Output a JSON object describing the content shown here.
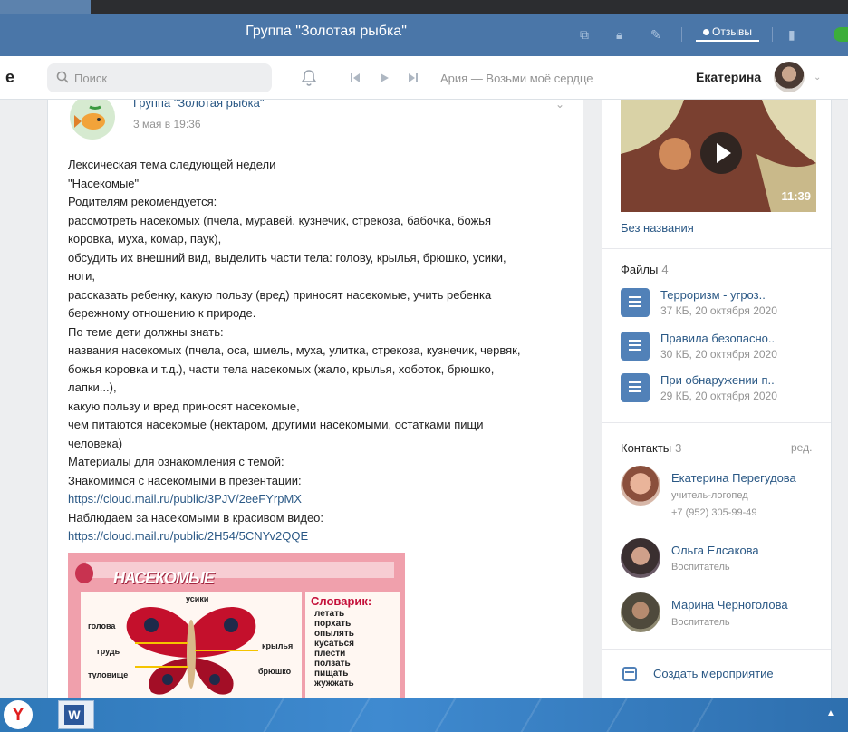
{
  "window": {
    "title": "Группа \"Золотая рыбка\"",
    "reviews_label": "Отзывы"
  },
  "header": {
    "logo_letter": "e",
    "search_placeholder": "Поиск",
    "track": "Ария — Возьми моё сердце",
    "user_name": "Екатерина"
  },
  "post": {
    "group_name": "Группа \"Золотая рыбка\"",
    "date": "3 мая в 19:36",
    "lines": [
      "Лексическая тема следующей недели",
      "\"Насекомые\"",
      "Родителям рекомендуется:",
      "рассмотреть насекомых (пчела, муравей, кузнечик, стрекоза, бабочка, божья",
      "коровка, муха, комар, паук),",
      "обсудить их внешний вид, выделить части тела: голову, крылья, брюшко, усики,",
      "ноги,",
      "рассказать ребенку, какую пользу (вред) приносят насекомые, учить ребенка",
      "бережному отношению к природе.",
      "По теме дети должны знать:",
      "названия насекомых (пчела, оса, шмель, муха, улитка, стрекоза, кузнечик, червяк,",
      "божья коровка и т.д.), части тела насекомых (жало, крылья, хоботок, брюшко,",
      "лапки...),",
      "какую пользу и вред приносят насекомые,",
      "чем питаются насекомые (нектаром, другими насекомыми, остатками пищи",
      "человека)",
      "Материалы для ознакомления с темой:",
      "Знакомимся с насекомыми в презентации:"
    ],
    "link1": "https://cloud.mail.ru/public/3PJV/2eeFYrpMX",
    "line_video": "Наблюдаем за насекомыми в красивом видео:",
    "link2": "https://cloud.mail.ru/public/2H54/5CNYv2QQE",
    "image": {
      "title": "НАСЕКОМЫЕ",
      "labels": {
        "antennae": "усики",
        "head": "голова",
        "chest": "грудь",
        "wings": "крылья",
        "torso": "туловище",
        "abdomen": "брюшко"
      },
      "dict_title": "Словарик:",
      "dict_words": [
        "летать",
        "порхать",
        "опылять",
        "кусаться",
        "плести",
        "ползать",
        "пищать",
        "жужжать"
      ]
    }
  },
  "sidebar": {
    "video_duration": "11:39",
    "video_title": "Без названия",
    "files_label": "Файлы",
    "files_count": "4",
    "files": [
      {
        "name": "Терроризм - угроз..",
        "meta": "37 КБ, 20 октября 2020"
      },
      {
        "name": "Правила безопасно..",
        "meta": "30 КБ, 20 октября 2020"
      },
      {
        "name": "При обнаружении п..",
        "meta": "29 КБ, 20 октября 2020"
      }
    ],
    "contacts_label": "Контакты",
    "contacts_count": "3",
    "contacts_edit": "ред.",
    "contacts": [
      {
        "name": "Екатерина Перегудова",
        "role": "учитель-логопед",
        "phone": "+7 (952) 305-99-49"
      },
      {
        "name": "Ольга Елсакова",
        "role": "Воспитатель"
      },
      {
        "name": "Марина Черноголова",
        "role": "Воспитатель"
      }
    ],
    "create_event": "Создать мероприятие"
  },
  "taskbar": {
    "yandex_letter": "Y",
    "word_letter": "W"
  }
}
